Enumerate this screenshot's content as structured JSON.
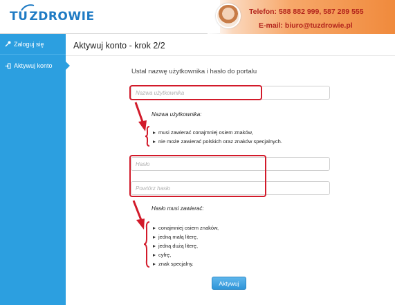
{
  "header": {
    "logo_part1": "TU",
    "logo_part2": "ZDROWIE",
    "phone": "Telefon: 588 882 999, 587 289 555",
    "email": "E-mail: biuro@tuzdrowie.pl"
  },
  "sidebar": {
    "items": [
      {
        "label": "Zaloguj się",
        "icon": "key-icon"
      },
      {
        "label": "Aktywuj konto",
        "icon": "signin-icon"
      }
    ]
  },
  "main": {
    "title": "Aktywuj konto - krok 2/2",
    "heading": "Ustal nazwę użytkownika i hasło do portalu",
    "username_placeholder": "Nazwa użytkownika",
    "password_placeholder": "Hasło",
    "password_repeat_placeholder": "Powtórz hasło",
    "username_rules_title": "Nazwa użytkownika:",
    "username_rules": [
      "musi zawierać conajmniej osiem znaków,",
      "nie może zawierać polskich oraz znaków specjalnych."
    ],
    "password_rules_title": "Hasło musi zawierać:",
    "password_rules": [
      "conajmniej osiem znaków,",
      "jedną małą literę,",
      "jedną dużą literę,",
      "cyfrę,",
      "znak specjalny."
    ],
    "submit_label": "Aktywuj"
  },
  "colors": {
    "sidebar": "#2c9fe0",
    "highlight": "#d21a2a",
    "accent_text": "#b3241c"
  }
}
